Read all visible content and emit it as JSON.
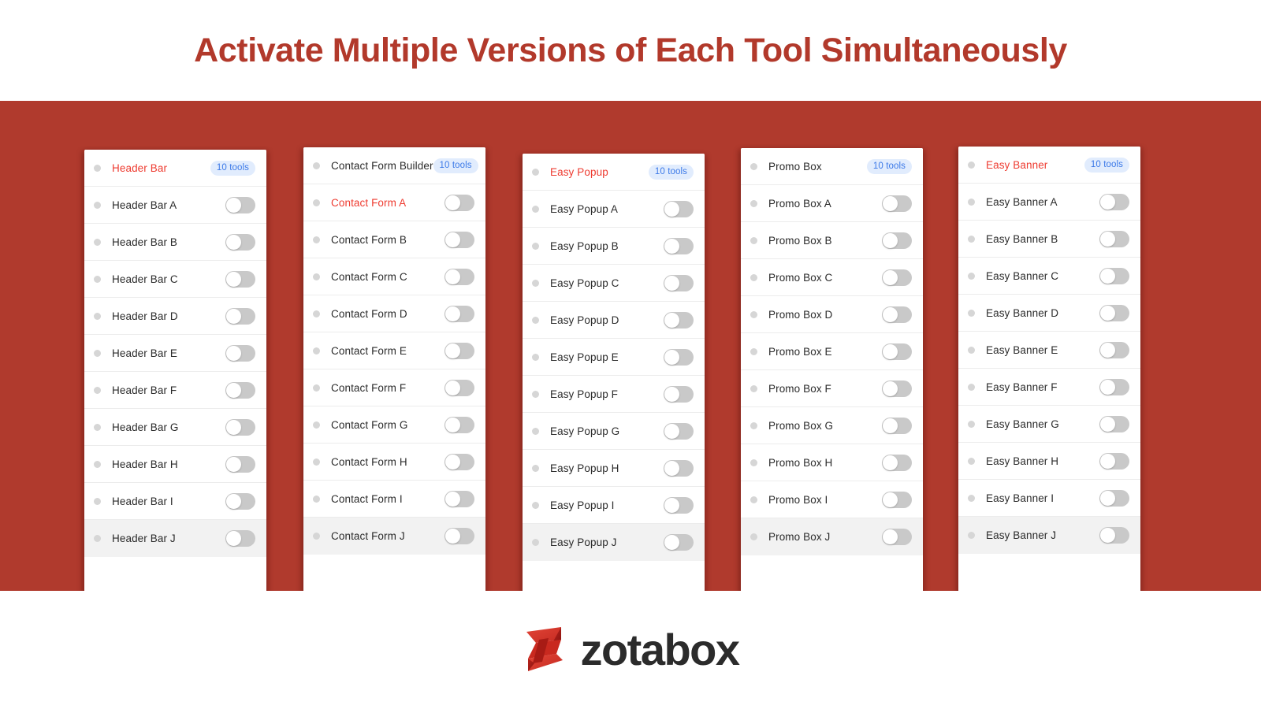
{
  "header": {
    "title": "Activate Multiple Versions of Each Tool Simultaneously",
    "title_color": "#b2392b"
  },
  "stage": {
    "background_color": "#b03a2d"
  },
  "badge": {
    "label": "10 tools",
    "text_color": "#3b79e8",
    "background_color": "#e1ecfd"
  },
  "accent_color": "#ee3b30",
  "toggle": {
    "state": "off",
    "track_color": "#c9c9c9",
    "knob_color": "#ffffff"
  },
  "cards": [
    {
      "id": "header-bar",
      "header": {
        "label": "Header Bar",
        "highlighted": true,
        "badge": "10 tools"
      },
      "rows": [
        {
          "label": "Header Bar A",
          "highlighted": false,
          "toggle": "off"
        },
        {
          "label": "Header Bar B",
          "highlighted": false,
          "toggle": "off"
        },
        {
          "label": "Header Bar C",
          "highlighted": false,
          "toggle": "off"
        },
        {
          "label": "Header Bar D",
          "highlighted": false,
          "toggle": "off"
        },
        {
          "label": "Header Bar E",
          "highlighted": false,
          "toggle": "off"
        },
        {
          "label": "Header Bar F",
          "highlighted": false,
          "toggle": "off"
        },
        {
          "label": "Header Bar G",
          "highlighted": false,
          "toggle": "off"
        },
        {
          "label": "Header Bar H",
          "highlighted": false,
          "toggle": "off"
        },
        {
          "label": "Header Bar I",
          "highlighted": false,
          "toggle": "off"
        },
        {
          "label": "Header Bar J",
          "highlighted": false,
          "toggle": "off"
        }
      ]
    },
    {
      "id": "contact-form-builder",
      "header": {
        "label": "Contact Form Builder",
        "highlighted": false,
        "badge": "10 tools"
      },
      "rows": [
        {
          "label": "Contact Form A",
          "highlighted": true,
          "toggle": "off"
        },
        {
          "label": "Contact Form B",
          "highlighted": false,
          "toggle": "off"
        },
        {
          "label": "Contact Form C",
          "highlighted": false,
          "toggle": "off"
        },
        {
          "label": "Contact Form D",
          "highlighted": false,
          "toggle": "off"
        },
        {
          "label": "Contact Form E",
          "highlighted": false,
          "toggle": "off"
        },
        {
          "label": "Contact Form F",
          "highlighted": false,
          "toggle": "off"
        },
        {
          "label": "Contact Form G",
          "highlighted": false,
          "toggle": "off"
        },
        {
          "label": "Contact Form H",
          "highlighted": false,
          "toggle": "off"
        },
        {
          "label": "Contact Form I",
          "highlighted": false,
          "toggle": "off"
        },
        {
          "label": "Contact Form J",
          "highlighted": false,
          "toggle": "off"
        }
      ]
    },
    {
      "id": "easy-popup",
      "header": {
        "label": "Easy Popup",
        "highlighted": true,
        "badge": "10 tools"
      },
      "rows": [
        {
          "label": "Easy Popup A",
          "highlighted": false,
          "toggle": "off"
        },
        {
          "label": "Easy Popup B",
          "highlighted": false,
          "toggle": "off"
        },
        {
          "label": "Easy Popup C",
          "highlighted": false,
          "toggle": "off"
        },
        {
          "label": "Easy Popup D",
          "highlighted": false,
          "toggle": "off"
        },
        {
          "label": "Easy Popup E",
          "highlighted": false,
          "toggle": "off"
        },
        {
          "label": "Easy Popup F",
          "highlighted": false,
          "toggle": "off"
        },
        {
          "label": "Easy Popup G",
          "highlighted": false,
          "toggle": "off"
        },
        {
          "label": "Easy Popup H",
          "highlighted": false,
          "toggle": "off"
        },
        {
          "label": "Easy Popup I",
          "highlighted": false,
          "toggle": "off"
        },
        {
          "label": "Easy Popup J",
          "highlighted": false,
          "toggle": "off"
        }
      ]
    },
    {
      "id": "promo-box",
      "header": {
        "label": "Promo Box",
        "highlighted": false,
        "badge": "10 tools"
      },
      "rows": [
        {
          "label": "Promo Box A",
          "highlighted": false,
          "toggle": "off"
        },
        {
          "label": "Promo Box B",
          "highlighted": false,
          "toggle": "off"
        },
        {
          "label": "Promo Box C",
          "highlighted": false,
          "toggle": "off"
        },
        {
          "label": "Promo Box D",
          "highlighted": false,
          "toggle": "off"
        },
        {
          "label": "Promo Box E",
          "highlighted": false,
          "toggle": "off"
        },
        {
          "label": "Promo Box F",
          "highlighted": false,
          "toggle": "off"
        },
        {
          "label": "Promo Box G",
          "highlighted": false,
          "toggle": "off"
        },
        {
          "label": "Promo Box H",
          "highlighted": false,
          "toggle": "off"
        },
        {
          "label": "Promo Box I",
          "highlighted": false,
          "toggle": "off"
        },
        {
          "label": "Promo Box J",
          "highlighted": false,
          "toggle": "off"
        }
      ]
    },
    {
      "id": "easy-banner",
      "header": {
        "label": "Easy Banner",
        "highlighted": true,
        "badge": "10 tools"
      },
      "rows": [
        {
          "label": "Easy Banner A",
          "highlighted": false,
          "toggle": "off"
        },
        {
          "label": "Easy Banner B",
          "highlighted": false,
          "toggle": "off"
        },
        {
          "label": "Easy Banner C",
          "highlighted": false,
          "toggle": "off"
        },
        {
          "label": "Easy Banner D",
          "highlighted": false,
          "toggle": "off"
        },
        {
          "label": "Easy Banner E",
          "highlighted": false,
          "toggle": "off"
        },
        {
          "label": "Easy Banner F",
          "highlighted": false,
          "toggle": "off"
        },
        {
          "label": "Easy Banner G",
          "highlighted": false,
          "toggle": "off"
        },
        {
          "label": "Easy Banner H",
          "highlighted": false,
          "toggle": "off"
        },
        {
          "label": "Easy Banner I",
          "highlighted": false,
          "toggle": "off"
        },
        {
          "label": "Easy Banner J",
          "highlighted": false,
          "toggle": "off"
        }
      ]
    }
  ],
  "footer": {
    "logo_wordmark": "zotabox",
    "logo_mark_name": "zotabox-z-logo",
    "logo_mark_color": "#d8372b",
    "logo_word_color": "#2b2b2b"
  }
}
